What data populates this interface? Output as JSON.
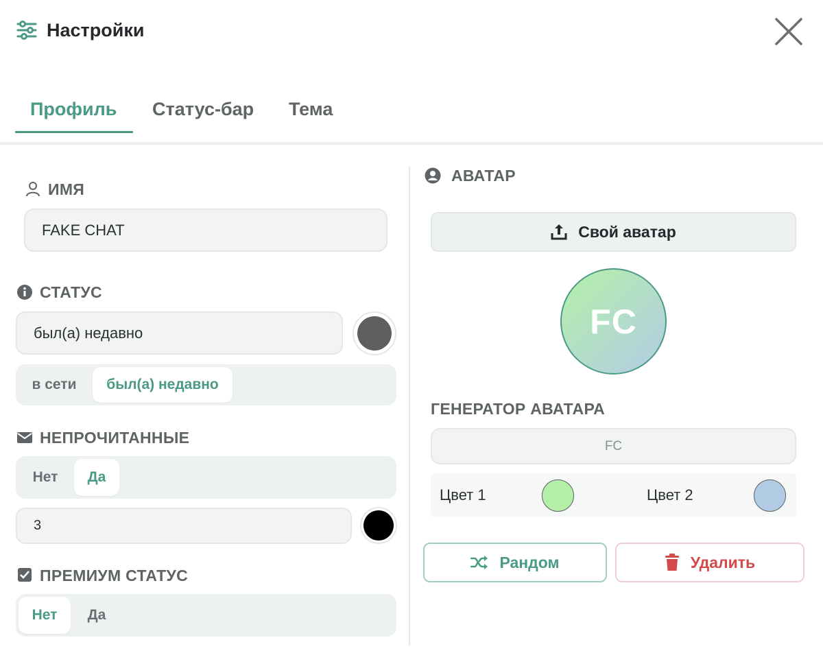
{
  "header": {
    "title": "Настройки",
    "icon": "sliders-icon",
    "close_icon": "close-icon"
  },
  "tabs": [
    {
      "label": "Профиль",
      "active": true
    },
    {
      "label": "Статус-бар",
      "active": false
    },
    {
      "label": "Тема",
      "active": false
    }
  ],
  "profile": {
    "name": {
      "label": "ИМЯ",
      "icon": "user-icon",
      "value": "FAKE CHAT"
    },
    "status": {
      "label": "СТАТУС",
      "icon": "info-icon",
      "value": "был(а) недавно",
      "color": "#5f5f5f",
      "options": [
        "в сети",
        "был(а) недавно"
      ],
      "selected": "был(а) недавно"
    },
    "unread": {
      "label": "НЕПРОЧИТАННЫЕ",
      "icon": "envelope-icon",
      "options": [
        "Нет",
        "Да"
      ],
      "selected": "Да",
      "count": "3",
      "color": "#000000"
    },
    "premium": {
      "label": "ПРЕМИУМ СТАТУС",
      "icon": "checkbox-icon",
      "options": [
        "Нет",
        "Да"
      ],
      "selected": "Нет"
    }
  },
  "avatar": {
    "label": "АВАТАР",
    "icon": "user-circle-icon",
    "upload_label": "Свой аватар",
    "upload_icon": "upload-icon",
    "initials": "FC",
    "generator": {
      "label": "ГЕНЕРАТОР АВАТАРА",
      "input_value": "FC",
      "color1_label": "Цвет 1",
      "color1": "#b4f0a8",
      "color2_label": "Цвет 2",
      "color2": "#b2cce6"
    },
    "random_label": "Рандом",
    "random_icon": "shuffle-icon",
    "delete_label": "Удалить",
    "delete_icon": "trash-icon"
  },
  "colors": {
    "accent": "#4a9a85",
    "danger": "#d44a4a"
  }
}
